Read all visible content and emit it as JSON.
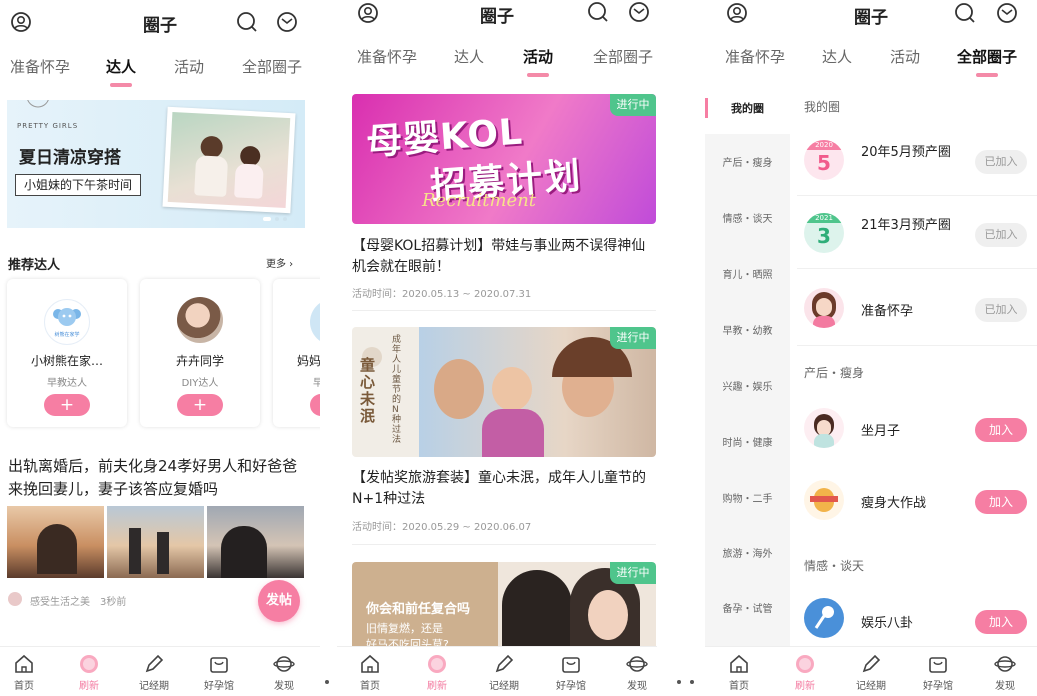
{
  "header": {
    "title": "圈子"
  },
  "tabs": [
    "准备怀孕",
    "达人",
    "活动",
    "全部圈子"
  ],
  "bottom_nav": [
    "首页",
    "刷新",
    "记经期",
    "好孕馆",
    "发现"
  ],
  "colors": {
    "accent": "#f67ea3",
    "text": "#222222",
    "muted": "#999999",
    "sidebar_bg": "#f5f5f5"
  },
  "experts_panel": {
    "banner": {
      "brand": "PRETTY GIRLS",
      "headline": "夏日清凉穿搭",
      "subline": "小姐妹的下午茶时间"
    },
    "recommend_title": "推荐达人",
    "more_label": "更多",
    "experts": [
      {
        "name": "小树熊在家…",
        "role": "早教达人",
        "logo_text": "树熊在家学"
      },
      {
        "name": "卉卉同学",
        "role": "DIY达人"
      },
      {
        "name": "妈妈",
        "role": "早"
      }
    ],
    "post": {
      "title": "出轨离婚后，前夫化身24孝好男人和好爸爸来挽回妻儿，妻子该答应复婚吗",
      "author": "感受生活之美",
      "time": "3秒前"
    },
    "fab_label": "发帖"
  },
  "activity_panel": {
    "status_label": "进行中",
    "time_prefix": "活动时间：",
    "items": [
      {
        "banner_title_line1": "母婴KOL",
        "banner_title_line2": "招募计划",
        "banner_script": "Recruitment",
        "title": "【母婴KOL招募计划】带娃与事业两不误得神仙机会就在眼前！",
        "time": "2020.05.13 ~ 2020.07.31"
      },
      {
        "banner_vertical_title": "童心未泯",
        "banner_vertical_sub": "成年人儿童节的N种过法",
        "title": "【发帖奖旅游套装】童心未泯，成年人儿童节的N+1种过法",
        "time": "2020.05.29 ~ 2020.06.07"
      },
      {
        "banner_title": "你会和前任复合吗",
        "banner_sub_line1": "旧情复燃，还是",
        "banner_sub_line2": "好马不吃回头草?"
      }
    ]
  },
  "all_circles_panel": {
    "sidebar": [
      "我的圈",
      "产后・瘦身",
      "情感・谈天",
      "育儿・晒照",
      "早教・幼教",
      "兴趣・娱乐",
      "时尚・健康",
      "购物・二手",
      "旅游・海外",
      "备孕・试管"
    ],
    "sections": [
      {
        "title": "我的圈",
        "items": [
          {
            "name": "20年5月预产圈",
            "badge_year": "2020",
            "badge_num": "5",
            "action": "已加入"
          },
          {
            "name": "21年3月预产圈",
            "badge_year": "2021",
            "badge_num": "3",
            "action": "已加入"
          },
          {
            "name": "准备怀孕",
            "action": "已加入"
          }
        ]
      },
      {
        "title": "产后・瘦身",
        "items": [
          {
            "name": "坐月子",
            "action": "加入"
          },
          {
            "name": "瘦身大作战",
            "action": "加入"
          }
        ]
      },
      {
        "title": "情感・谈天",
        "items": [
          {
            "name": "娱乐八卦",
            "action": "加入"
          }
        ]
      }
    ]
  }
}
